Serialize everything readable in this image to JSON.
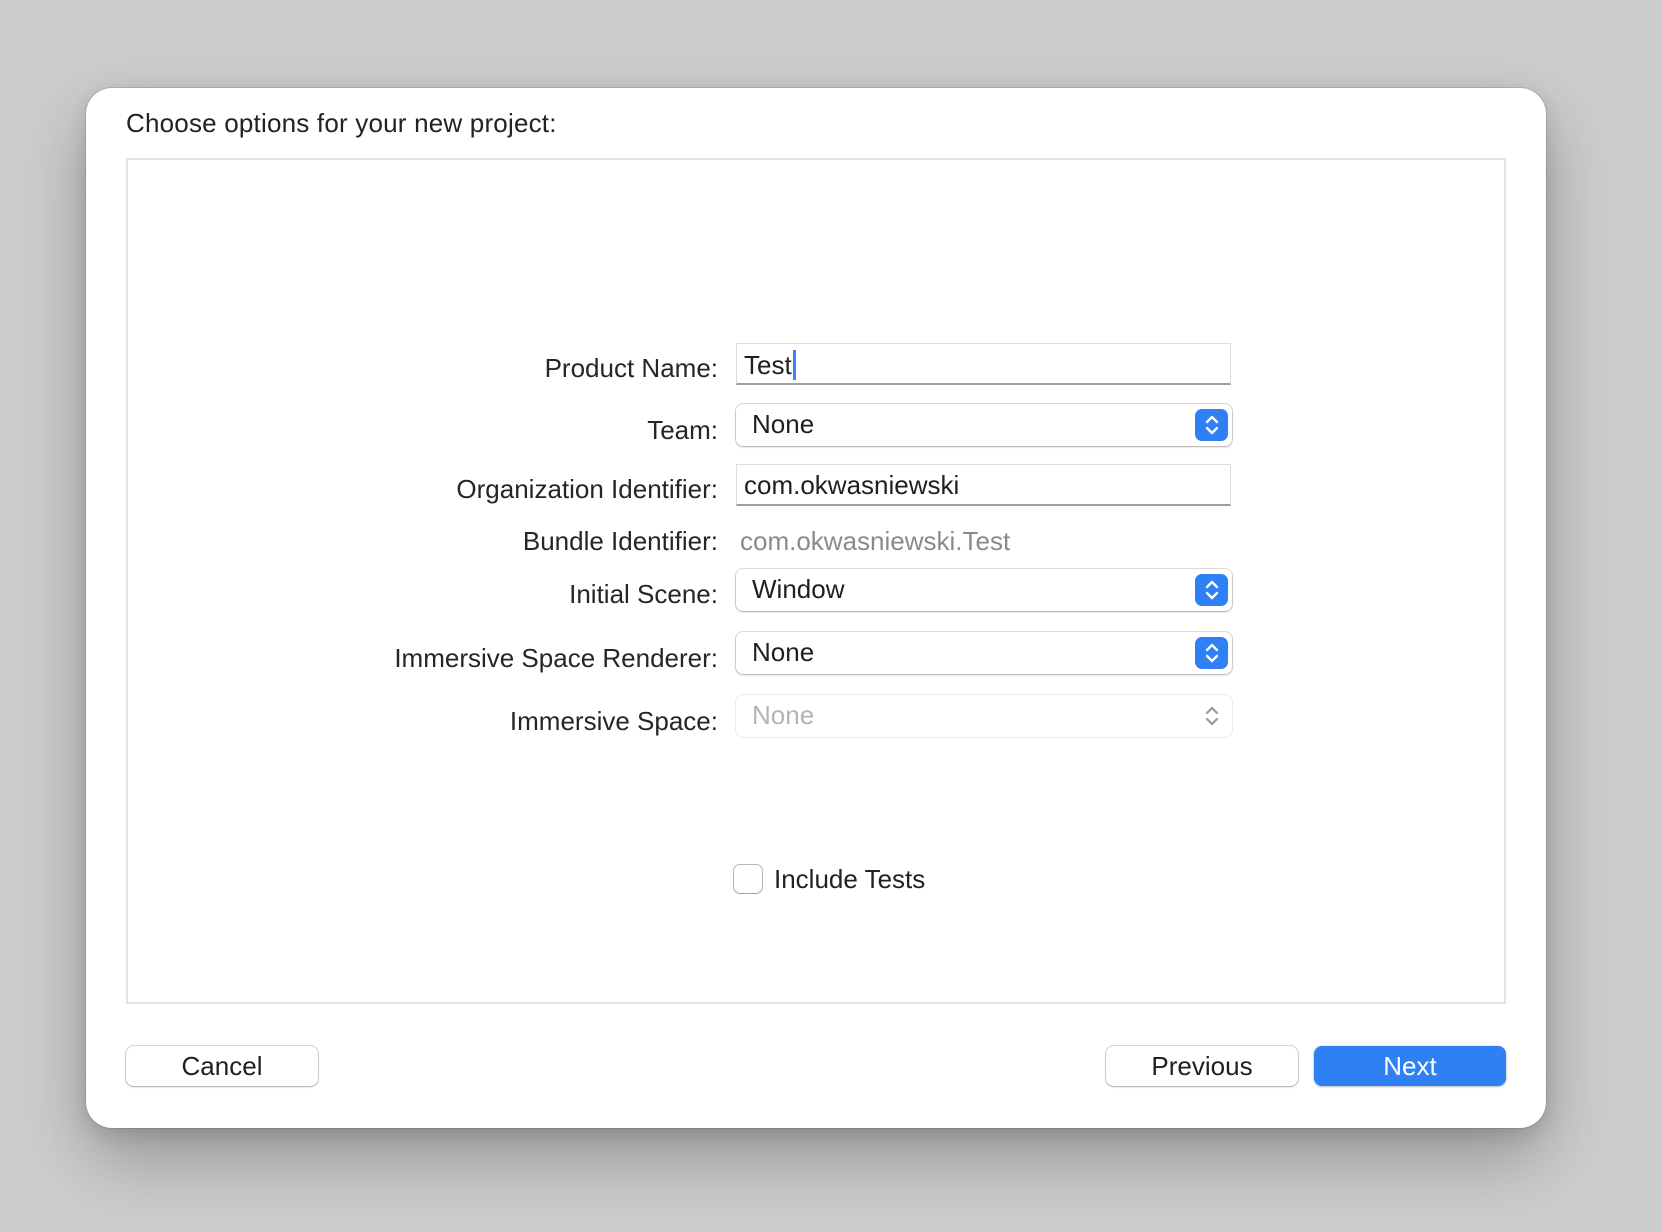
{
  "dialog": {
    "title": "Choose options for your new project:"
  },
  "form": {
    "product_name": {
      "label": "Product Name:",
      "value": "Test"
    },
    "team": {
      "label": "Team:",
      "value": "None",
      "icon": "popup-chevrons-icon"
    },
    "organization_identifier": {
      "label": "Organization Identifier:",
      "value": "com.okwasniewski"
    },
    "bundle_identifier": {
      "label": "Bundle Identifier:",
      "value": "com.okwasniewski.Test"
    },
    "initial_scene": {
      "label": "Initial Scene:",
      "value": "Window",
      "icon": "popup-chevrons-icon"
    },
    "immersive_space_renderer": {
      "label": "Immersive Space Renderer:",
      "value": "None",
      "icon": "popup-chevrons-icon"
    },
    "immersive_space": {
      "label": "Immersive Space:",
      "value": "None",
      "icon": "popup-chevrons-icon",
      "disabled": true
    },
    "include_tests": {
      "label": "Include Tests",
      "checked": false
    }
  },
  "buttons": {
    "cancel": "Cancel",
    "previous": "Previous",
    "next": "Next"
  },
  "colors": {
    "accent": "#2f7ff5",
    "backdrop": "#cdcdcd",
    "secondary_text": "#8a8a8a"
  }
}
